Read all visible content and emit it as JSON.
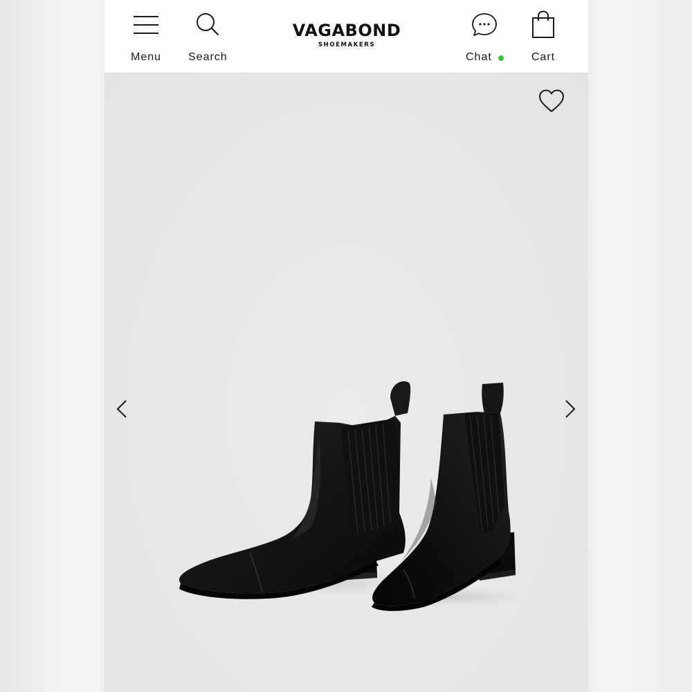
{
  "header": {
    "menu": {
      "label": "Menu",
      "icon": "menu-icon"
    },
    "search": {
      "label": "Search",
      "icon": "search-icon"
    },
    "logo": {
      "brand": "VAGABOND",
      "subtitle": "SHOEMAKERS"
    },
    "chat": {
      "label": "Chat",
      "icon": "chat-bubble-icon",
      "status_color": "#3cc13b"
    },
    "cart": {
      "label": "Cart",
      "icon": "shopping-bag-icon"
    }
  },
  "gallery": {
    "wishlist_icon": "heart-outline-icon",
    "prev_icon": "chevron-left-icon",
    "next_icon": "chevron-right-icon",
    "image": "pair-of-black-leather-chelsea-ankle-boots"
  },
  "colors": {
    "header_bg": "#ffffff",
    "gallery_bg": "#e8e8e8",
    "text": "#1a1a1a"
  }
}
